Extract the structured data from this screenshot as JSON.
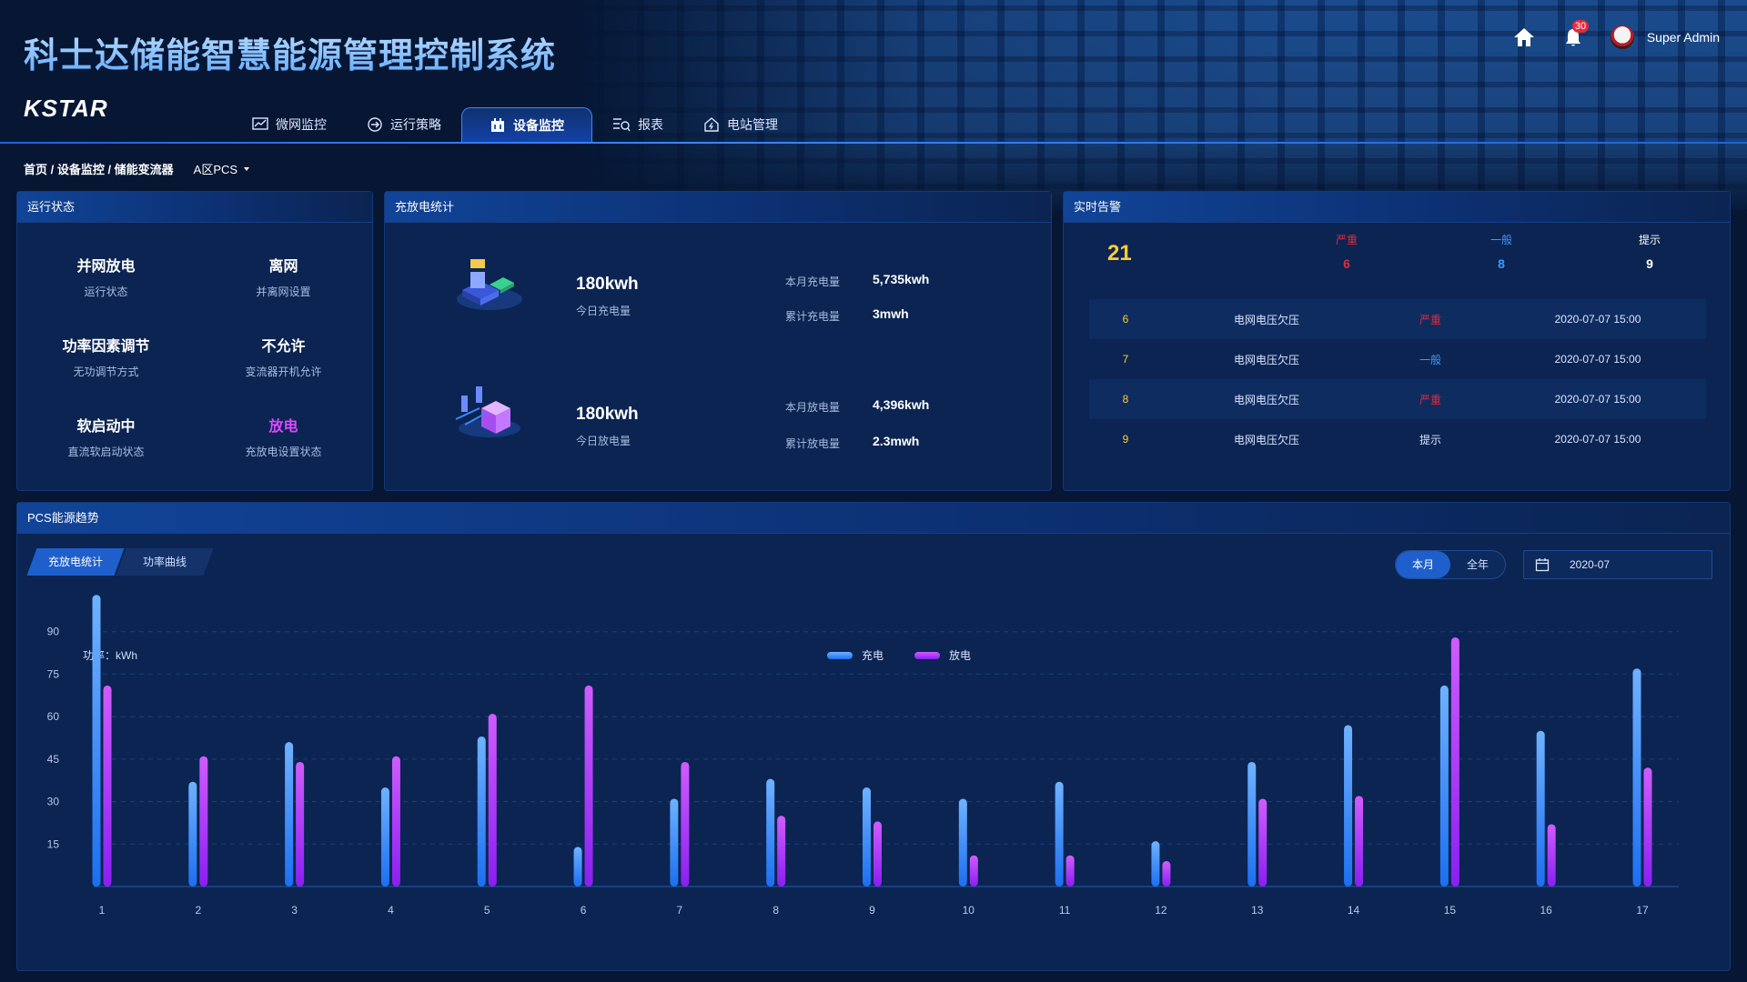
{
  "app": {
    "title": "科士达储能智慧能源管理控制系统",
    "logo": "KSTAR"
  },
  "header": {
    "notification_count": "30",
    "user_name": "Super Admin"
  },
  "nav": [
    {
      "label": "微网监控",
      "icon": "chart-icon",
      "active": false
    },
    {
      "label": "运行策略",
      "icon": "strategy-icon",
      "active": false
    },
    {
      "label": "设备监控",
      "icon": "device-icon",
      "active": true
    },
    {
      "label": "报表",
      "icon": "report-icon",
      "active": false
    },
    {
      "label": "电站管理",
      "icon": "station-icon",
      "active": false
    }
  ],
  "breadcrumb": {
    "path": "首页 / 设备监控 / 储能变流器",
    "device": "A区PCS"
  },
  "run_status": {
    "title": "运行状态",
    "items": [
      {
        "value": "并网放电",
        "label": "运行状态"
      },
      {
        "value": "离网",
        "label": "并离网设置"
      },
      {
        "value": "功率因素调节",
        "label": "无功调节方式"
      },
      {
        "value": "不允许",
        "label": "变流器开机允许"
      },
      {
        "value": "软启动中",
        "label": "直流软启动状态"
      },
      {
        "value": "放电",
        "label": "充放电设置状态",
        "accent": "#d84bff"
      }
    ]
  },
  "charge_stats": {
    "title": "充放电统计",
    "charge": {
      "today_value": "180kwh",
      "today_label": "今日充电量",
      "month_label": "本月充电量",
      "month_value": "5,735kwh",
      "total_label": "累计充电量",
      "total_value": "3mwh"
    },
    "discharge": {
      "today_value": "180kwh",
      "today_label": "今日放电量",
      "month_label": "本月放电量",
      "month_value": "4,396kwh",
      "total_label": "累计放电量",
      "total_value": "2.3mwh"
    }
  },
  "alarms": {
    "title": "实时告警",
    "total": "21",
    "levels": [
      {
        "label": "严重",
        "count": "6",
        "color": "#e12b3b"
      },
      {
        "label": "一般",
        "count": "8",
        "color": "#3b9bff"
      },
      {
        "label": "提示",
        "count": "9",
        "color": "#ffffff"
      }
    ],
    "rows": [
      {
        "num": "6",
        "desc": "电网电压欠压",
        "level": "严重",
        "level_color": "#e12b3b",
        "time": "2020-07-07 15:00"
      },
      {
        "num": "7",
        "desc": "电网电压欠压",
        "level": "一般",
        "level_color": "#3b9bff",
        "time": "2020-07-07 15:00"
      },
      {
        "num": "8",
        "desc": "电网电压欠压",
        "level": "严重",
        "level_color": "#e12b3b",
        "time": "2020-07-07 15:00"
      },
      {
        "num": "9",
        "desc": "电网电压欠压",
        "level": "提示",
        "level_color": "#dbe6ff",
        "time": "2020-07-07 15:00"
      }
    ]
  },
  "trend": {
    "title": "PCS能源趋势",
    "tabs": [
      "充放电统计",
      "功率曲线"
    ],
    "range_options": [
      "本月",
      "全年"
    ],
    "date": "2020-07"
  },
  "chart_data": {
    "type": "bar",
    "ylabel": "功率：kWh",
    "yticks": [
      15,
      30,
      45,
      60,
      75,
      90
    ],
    "ylim": [
      0,
      105
    ],
    "categories": [
      "1",
      "2",
      "3",
      "4",
      "5",
      "6",
      "7",
      "8",
      "9",
      "10",
      "11",
      "12",
      "13",
      "14",
      "15",
      "16",
      "17"
    ],
    "series": [
      {
        "name": "充电",
        "color": "#2f8cff",
        "values": [
          103,
          37,
          51,
          35,
          53,
          14,
          31,
          38,
          35,
          31,
          37,
          16,
          44,
          57,
          71,
          55,
          77
        ]
      },
      {
        "name": "放电",
        "color": "#b02cff",
        "values": [
          71,
          46,
          44,
          46,
          61,
          71,
          44,
          25,
          23,
          11,
          11,
          9,
          31,
          32,
          88,
          22,
          42
        ]
      }
    ],
    "legend_position": "top-center",
    "grid": true
  }
}
